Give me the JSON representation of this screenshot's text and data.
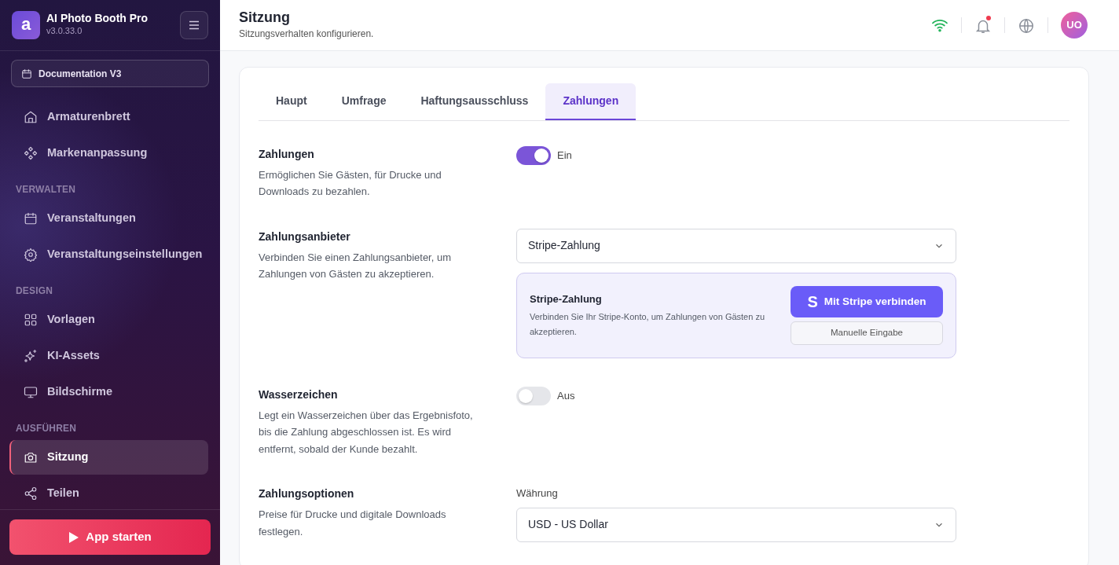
{
  "app": {
    "logo_letter": "a",
    "title": "AI Photo Booth Pro",
    "version": "v3.0.33.0"
  },
  "event_selector": {
    "label": "Documentation V3"
  },
  "sidebar": {
    "sections": [
      {
        "items": [
          {
            "label": "Armaturenbrett",
            "selected": false
          },
          {
            "label": "Markenanpassung",
            "selected": false
          }
        ]
      },
      {
        "heading": "VERWALTEN",
        "items": [
          {
            "label": "Veranstaltungen",
            "selected": false
          },
          {
            "label": "Veranstaltungseinstellungen",
            "selected": false
          }
        ]
      },
      {
        "heading": "DESIGN",
        "items": [
          {
            "label": "Vorlagen",
            "selected": false
          },
          {
            "label": "KI-Assets",
            "selected": false
          },
          {
            "label": "Bildschirme",
            "selected": false
          }
        ]
      },
      {
        "heading": "AUSFÜHREN",
        "items": [
          {
            "label": "Sitzung",
            "selected": true
          },
          {
            "label": "Teilen",
            "selected": false
          }
        ]
      }
    ]
  },
  "launch_button": {
    "label": "App starten"
  },
  "header": {
    "title": "Sitzung",
    "subtitle": "Sitzungsverhalten konfigurieren.",
    "notification_unread": true,
    "avatar": "UO"
  },
  "tabs": [
    {
      "label": "Haupt",
      "selected": false
    },
    {
      "label": "Umfrage",
      "selected": false
    },
    {
      "label": "Haftungsausschluss",
      "selected": false
    },
    {
      "label": "Zahlungen",
      "selected": true
    }
  ],
  "settings": [
    {
      "kind": "toggle",
      "title": "Zahlungen",
      "description": "Ermöglichen Sie Gästen, für Drucke und Downloads zu bezahlen.",
      "on": true,
      "state_label": "Ein"
    },
    {
      "kind": "provider",
      "title": "Zahlungsanbieter",
      "description": "Verbinden Sie einen Zahlungsanbieter, um Zahlungen von Gästen zu akzeptieren.",
      "value": "Stripe-Zahlung",
      "panel": {
        "title": "Stripe-Zahlung",
        "text": "Verbinden Sie Ihr Stripe-Konto, um Zahlungen von Gästen zu akzeptieren.",
        "logo": "S",
        "connect": "Mit Stripe verbinden",
        "manual": "Manuelle Eingabe"
      }
    },
    {
      "kind": "toggle",
      "title": "Wasserzeichen",
      "description": "Legt ein Wasserzeichen über das Ergebnisfoto, bis die Zahlung abgeschlossen ist. Es wird entfernt, sobald der Kunde bezahlt.",
      "on": false,
      "state_label": "Aus"
    },
    {
      "kind": "select",
      "title": "Zahlungsoptionen",
      "description": "Preise für Drucke und digitale Downloads festlegen.",
      "field_label": "Währung",
      "value": "USD - US Dollar"
    }
  ]
}
